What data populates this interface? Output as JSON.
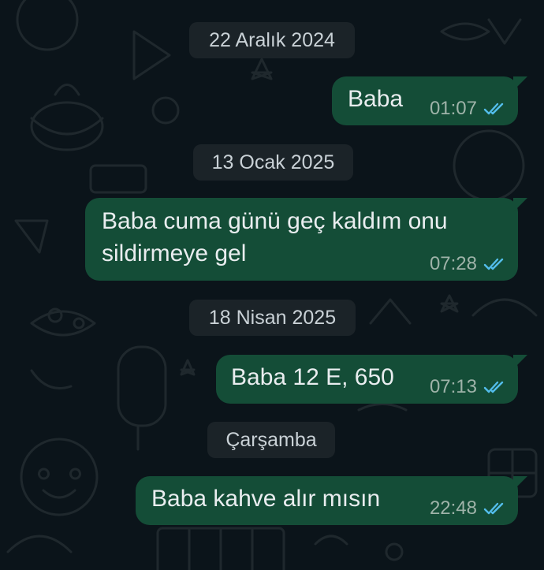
{
  "colors": {
    "background": "#0b141a",
    "bubble_outgoing": "#144d37",
    "date_chip": "#1b2328",
    "read_ticks": "#53bdeb"
  },
  "chat": {
    "items": [
      {
        "type": "date",
        "label": "22 Aralık 2024"
      },
      {
        "type": "message",
        "lines": [
          "Baba"
        ],
        "time": "01:07",
        "status_icon": "double-check-read-icon"
      },
      {
        "type": "date",
        "label": "13 Ocak 2025"
      },
      {
        "type": "message",
        "lines": [
          "Baba cuma günü geç kaldım onu",
          "sildirmeye gel"
        ],
        "time": "07:28",
        "status_icon": "double-check-read-icon"
      },
      {
        "type": "date",
        "label": "18 Nisan 2025"
      },
      {
        "type": "message",
        "lines": [
          "Baba 12 E, 650"
        ],
        "time": "07:13",
        "status_icon": "double-check-read-icon"
      },
      {
        "type": "date",
        "label": "Çarşamba"
      },
      {
        "type": "message",
        "lines": [
          "Baba kahve alır mısın"
        ],
        "time": "22:48",
        "status_icon": "double-check-read-icon"
      }
    ]
  }
}
